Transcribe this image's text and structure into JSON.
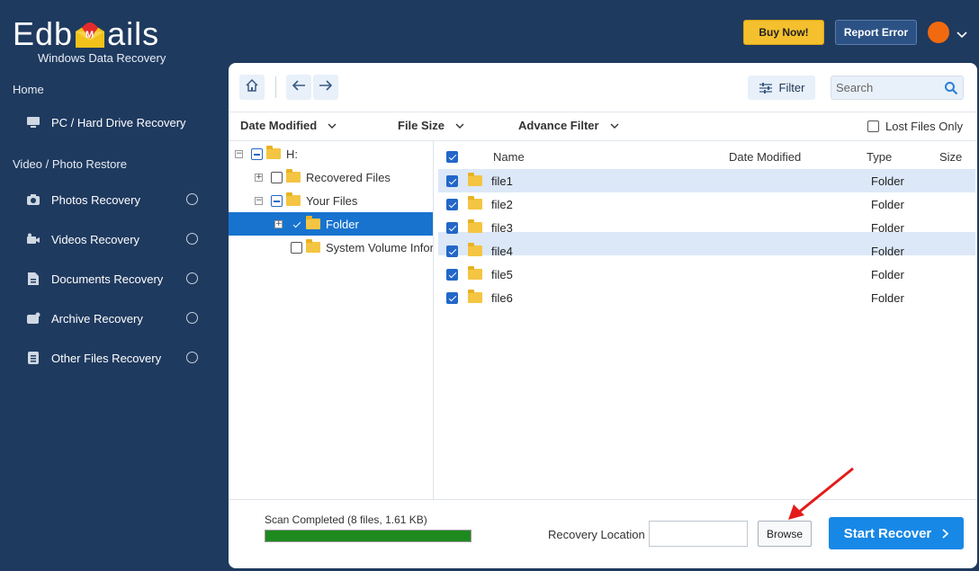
{
  "app": {
    "logo_text_left": "Edb",
    "logo_text_right": "ails",
    "logo_mark_letter": "M",
    "subtitle": "Windows Data Recovery"
  },
  "header": {
    "buy_label": "Buy Now!",
    "report_label": "Report Error"
  },
  "sidebar": {
    "home_label": "Home",
    "pc_recovery_label": "PC / Hard Drive Recovery",
    "section_label": "Video / Photo Restore",
    "items": [
      {
        "label": "Photos Recovery",
        "icon": "camera-icon"
      },
      {
        "label": "Videos Recovery",
        "icon": "video-icon"
      },
      {
        "label": "Documents Recovery",
        "icon": "document-icon"
      },
      {
        "label": "Archive Recovery",
        "icon": "archive-icon"
      },
      {
        "label": "Other Files Recovery",
        "icon": "file-icon"
      }
    ]
  },
  "toolbar": {
    "filter_label": "Filter",
    "search_placeholder": "Search"
  },
  "filters": {
    "date_modified": "Date Modified",
    "file_size": "File Size",
    "advance_filter": "Advance Filter",
    "lost_files_only": "Lost Files Only"
  },
  "tree": {
    "root": "H:",
    "recovered": "Recovered Files",
    "your_files": "Your Files",
    "folder": "Folder",
    "system_volume": "System Volume Infor"
  },
  "list": {
    "columns": {
      "name": "Name",
      "date_modified": "Date Modified",
      "type": "Type",
      "size": "Size"
    },
    "rows": [
      {
        "name": "file1",
        "type": "Folder"
      },
      {
        "name": "file2",
        "type": "Folder"
      },
      {
        "name": "file3",
        "type": "Folder"
      },
      {
        "name": "file4",
        "type": "Folder"
      },
      {
        "name": "file5",
        "type": "Folder"
      },
      {
        "name": "file6",
        "type": "Folder"
      }
    ]
  },
  "footer": {
    "status": "Scan Completed (8 files, 1.61 KB)",
    "progress_percent": 100,
    "recovery_location_label": "Recovery Location",
    "recovery_location_value": "",
    "browse_label": "Browse",
    "start_label": "Start Recover"
  },
  "colors": {
    "sidebar_bg": "#1f3a5f",
    "accent": "#1888e6",
    "buy": "#f5c02e",
    "progress": "#1e8a1e",
    "selection": "#1873cf"
  }
}
